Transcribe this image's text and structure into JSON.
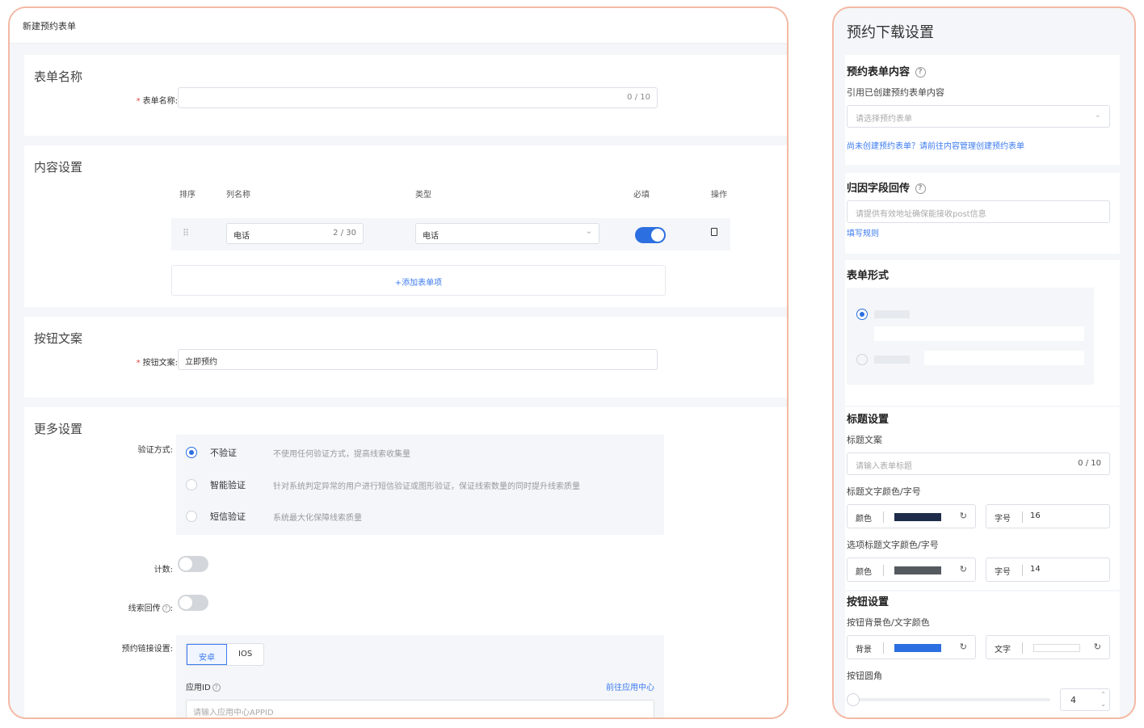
{
  "left": {
    "header_title": "新建预约表单",
    "form_name": {
      "section": "表单名称",
      "label": "表单名称:",
      "counter": "0 / 10"
    },
    "content": {
      "section": "内容设置",
      "columns": [
        "排序",
        "列名称",
        "类型",
        "必填",
        "操作"
      ],
      "row": {
        "name": "电话",
        "counter": "2 / 30",
        "type": "电话",
        "required": true
      },
      "add_label": "+添加表单项"
    },
    "button_text": {
      "section": "按钮文案",
      "label": "按钮文案:",
      "value": "立即预约"
    },
    "more": {
      "section": "更多设置",
      "verify_label": "验证方式:",
      "verify_options": [
        {
          "name": "不验证",
          "desc": "不使用任何验证方式，提高线索收集量",
          "selected": true
        },
        {
          "name": "智能验证",
          "desc": "针对系统判定异常的用户进行短信验证或图形验证，保证线索数量的同时提升线索质量",
          "selected": false
        },
        {
          "name": "短信验证",
          "desc": "系统最大化保障线索质量",
          "selected": false
        }
      ],
      "count_label": "计数:",
      "callback_label": "线索回传",
      "link_label": "预约链接设置:",
      "tabs": [
        "安卓",
        "IOS"
      ],
      "appid_label": "应用ID",
      "appid_link": "前往应用中心",
      "appid_placeholder": "请输入应用中心APPID"
    }
  },
  "right": {
    "title": "预约下载设置",
    "form_content": {
      "heading": "预约表单内容",
      "sub": "引用已创建预约表单内容",
      "placeholder": "请选择预约表单",
      "link": "尚未创建预约表单？请前往内容管理创建预约表单"
    },
    "attribution": {
      "heading": "归因字段回传",
      "placeholder": "请提供有效地址确保能接收post信息",
      "link": "填写规则"
    },
    "form_style": {
      "heading": "表单形式"
    },
    "title_settings": {
      "heading": "标题设置",
      "text_label": "标题文案",
      "placeholder": "请输入表单标题",
      "counter": "0 / 10",
      "color_label": "标题文字颜色/字号",
      "color_word": "颜色",
      "size_word": "字号",
      "color1": "#1f2d4a",
      "size1": "16",
      "option_label": "选项标题文字颜色/字号",
      "color2": "#555a60",
      "size2": "14"
    },
    "button_settings": {
      "heading": "按钮设置",
      "color_label": "按钮背景色/文字颜色",
      "bg_word": "背景",
      "text_word": "文字",
      "bg_color": "#2c6fe0",
      "text_color": "#ffffff",
      "radius_label": "按钮圆角",
      "radius_value": "4"
    }
  }
}
